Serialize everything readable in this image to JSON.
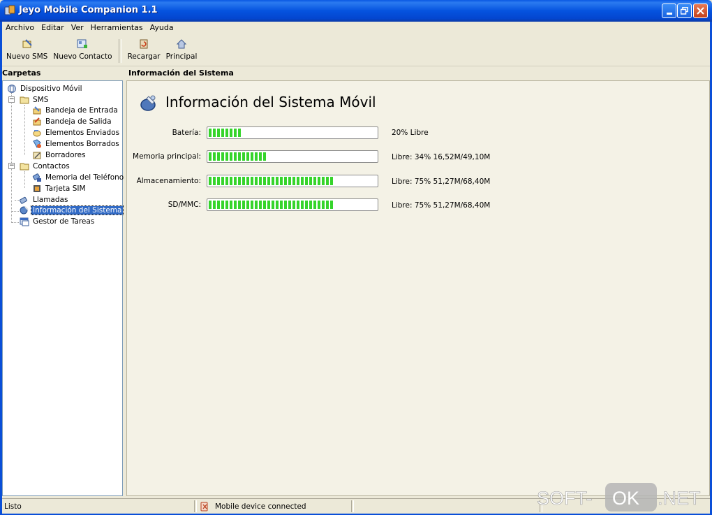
{
  "window": {
    "title": "Jeyo Mobile Companion 1.1"
  },
  "menu": [
    "Archivo",
    "Editar",
    "Ver",
    "Herramientas",
    "Ayuda"
  ],
  "toolbar": {
    "new_sms": "Nuevo SMS",
    "new_contact": "Nuevo Contacto",
    "reload": "Recargar",
    "home": "Principal"
  },
  "panels": {
    "folders_header": "Carpetas",
    "content_header": "Información del Sistema"
  },
  "tree": {
    "root": "Dispositivo Móvil",
    "sms": "SMS",
    "inbox": "Bandeja de Entrada",
    "outbox": "Bandeja de Salida",
    "sent": "Elementos Enviados",
    "deleted": "Elementos Borrados",
    "drafts": "Borradores",
    "contacts": "Contactos",
    "phone_memory": "Memoria del Teléfono",
    "sim_card": "Tarjeta SIM",
    "calls": "Llamadas",
    "system_info": "Información del Sistema",
    "task_manager": "Gestor de Tareas"
  },
  "content": {
    "title": "Información del Sistema Móvil",
    "rows": [
      {
        "label": "Batería:",
        "fill": 0.2,
        "value": "20% Libre"
      },
      {
        "label": "Memoria principal:",
        "fill": 0.34,
        "value": "Libre: 34% 16,52M/49,10M"
      },
      {
        "label": "Almacenamiento:",
        "fill": 0.75,
        "value": "Libre: 75% 51,27M/68,40M"
      },
      {
        "label": "SD/MMC:",
        "fill": 0.75,
        "value": "Libre: 75% 51,27M/68,40M"
      }
    ]
  },
  "status": {
    "left": "Listo",
    "connection": "Mobile device connected"
  },
  "watermark": "SOFT-OK.NET",
  "colors": {
    "bar_fill": "#36d42b",
    "selection": "#316ac5",
    "titlebar": "#0553df"
  }
}
